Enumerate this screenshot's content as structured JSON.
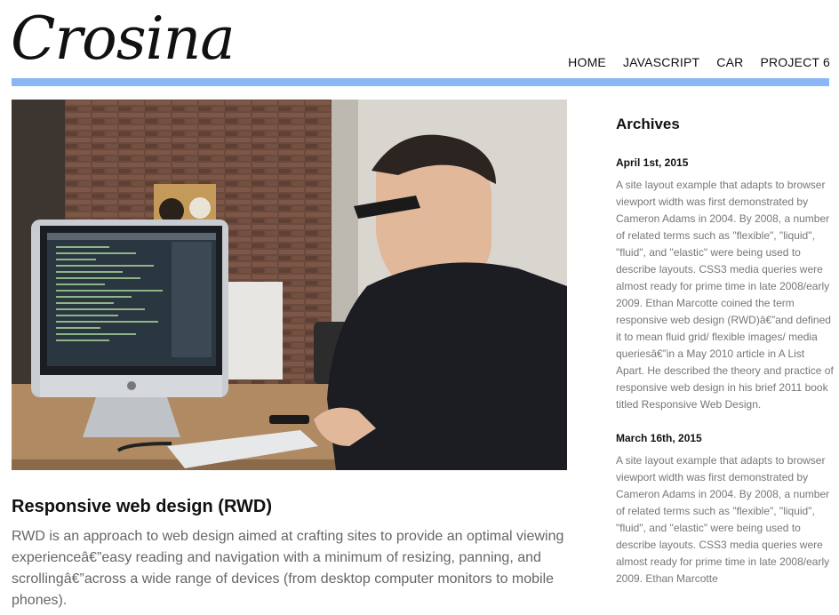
{
  "brand": {
    "logo": "Crosina"
  },
  "nav": [
    {
      "label": "HOME"
    },
    {
      "label": "JAVASCRIPT"
    },
    {
      "label": "CAR"
    },
    {
      "label": "PROJECT 6"
    }
  ],
  "colors": {
    "accent_bar": "#8ab6f5"
  },
  "post": {
    "title": "Responsive web design (RWD)",
    "body": "RWD is an approach to web design aimed at crafting sites to provide an optimal viewing experienceâ€”easy reading and navigation with a minimum of resizing, panning, and scrollingâ€”across a wide range of devices (from desktop computer monitors to mobile phones)."
  },
  "sidebar": {
    "heading": "Archives",
    "entries": [
      {
        "date": "April 1st, 2015",
        "text": "A site layout example that adapts to browser viewport width was first demonstrated by Cameron Adams in 2004. By 2008, a number of related terms such as \"flexible\", \"liquid\", \"fluid\", and \"elastic\" were being used to describe layouts. CSS3 media queries were almost ready for prime time in late 2008/early 2009. Ethan Marcotte coined the term responsive web design (RWD)â€”and defined it to mean fluid grid/ flexible images/ media queriesâ€”in a May 2010 article in A List Apart. He described the theory and practice of responsive web design in his brief 2011 book titled Responsive Web Design."
      },
      {
        "date": "March 16th, 2015",
        "text": "A site layout example that adapts to browser viewport width was first demonstrated by Cameron Adams in 2004. By 2008, a number of related terms such as \"flexible\", \"liquid\", \"fluid\", and \"elastic\" were being used to describe layouts. CSS3 media queries were almost ready for prime time in late 2008/early 2009. Ethan Marcotte"
      }
    ]
  }
}
